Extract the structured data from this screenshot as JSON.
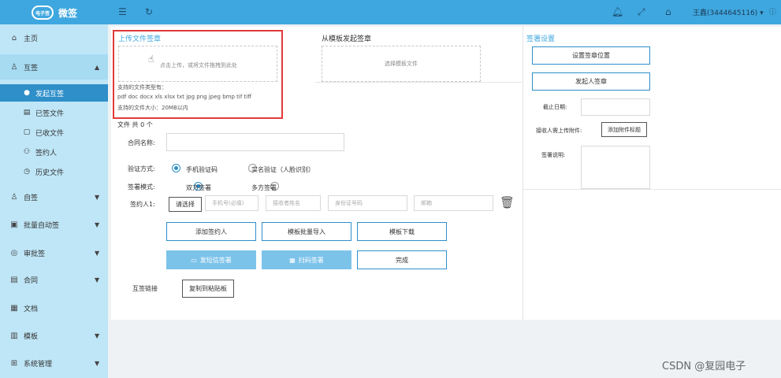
{
  "app": {
    "logo_badge": "电子签",
    "logo_text": "微签"
  },
  "topbar": {
    "user": "王鑫(3444645116)"
  },
  "sidebar": {
    "items": [
      {
        "label": "主页"
      },
      {
        "label": "互签"
      },
      {
        "label": "自签"
      },
      {
        "label": "批量自动签"
      },
      {
        "label": "审批签"
      },
      {
        "label": "合同"
      },
      {
        "label": "文档"
      },
      {
        "label": "模板"
      },
      {
        "label": "系统管理"
      }
    ],
    "sub": [
      {
        "label": "发起互签"
      },
      {
        "label": "已签文件"
      },
      {
        "label": "已收文件"
      },
      {
        "label": "签约人"
      },
      {
        "label": "历史文件"
      }
    ]
  },
  "upload": {
    "title": "上传文件签章",
    "drop_hint": "点击上传，或将文件拖拽到此处",
    "types_label": "支持的文件类型有：",
    "types": "pdf doc docx xls xlsx txt jpg png jpeg bmp tif tiff",
    "size_label": "支持的文件大小：20MB以内"
  },
  "template": {
    "title": "从模板发起签章",
    "select": "选择模板文件"
  },
  "file_count": "文件 共 0 个",
  "form": {
    "contract_name_label": "合同名称:",
    "verify_label": "验证方式:",
    "verify_opt1": "手机验证码",
    "verify_opt2": "实名验证（人脸识别）",
    "mode_label": "签署模式:",
    "mode_opt1": "双方签署",
    "mode_opt2": "多方签署",
    "signer_label": "签约人1:",
    "choose_btn": "请选择",
    "phone_ph": "手机号(必填)",
    "name_ph": "接收者姓名",
    "id_ph": "身份证号码",
    "email_ph": "邮箱",
    "add_signer": "添加签约人",
    "batch_import": "模板批量导入",
    "template_download": "模板下载",
    "sms_sign": "发短信签署",
    "qr_sign": "扫码签署",
    "done": "完成",
    "link_label": "互签链接",
    "copy_btn": "复制到粘贴板"
  },
  "settings": {
    "title": "签署设置",
    "set_pos": "设置签章位置",
    "initiator_sign": "发起人签章",
    "deadline_label": "截止日期:",
    "attach_label": "接收人需上传附件:",
    "attach_btn": "添加附件标题",
    "note_label": "签署说明:"
  },
  "watermark": "CSDN @复园电子",
  "colors": {
    "topbar": "#3fa7df",
    "sidebar": "#bfe6f7",
    "active": "#2e8fc9",
    "highlight": "#e23a3a"
  }
}
